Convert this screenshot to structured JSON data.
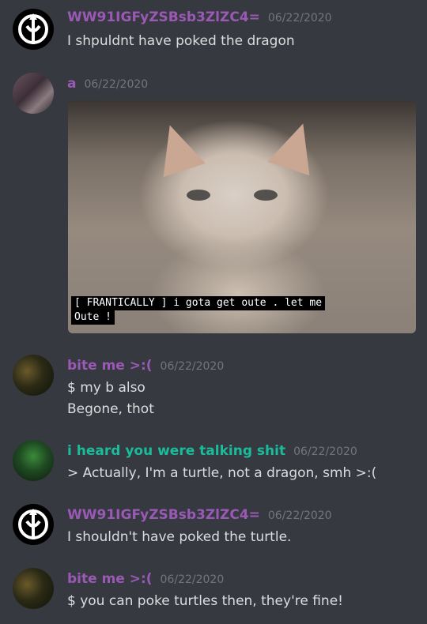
{
  "messages": [
    {
      "author": "WW91IGFyZSBsb3ZlZC4=",
      "timestamp": "06/22/2020",
      "lines": [
        "I shpuldnt have poked the dragon"
      ]
    },
    {
      "author": "a",
      "timestamp": "06/22/2020",
      "attachment": {
        "caption_line1": "[ FRANTICALLY ] i gota get oute .  let me",
        "caption_line2": "Oute !"
      }
    },
    {
      "author": "bite me >:(",
      "timestamp": "06/22/2020",
      "lines": [
        "$ my b also",
        "Begone, thot"
      ]
    },
    {
      "author": "i heard you were talking shit",
      "timestamp": "06/22/2020",
      "lines": [
        "> Actually, I'm a turtle, not a dragon, smh >:("
      ]
    },
    {
      "author": "WW91IGFyZSBsb3ZlZC4=",
      "timestamp": "06/22/2020",
      "lines": [
        "I shouldn't have poked the turtle."
      ]
    },
    {
      "author": "bite me >:(",
      "timestamp": "06/22/2020",
      "lines": [
        "$ you can poke turtles then, they're fine!"
      ]
    }
  ],
  "colors": {
    "background": "#36393f",
    "username_purple": "#9b59b6",
    "username_teal": "#1abc9c",
    "timestamp": "#72767d",
    "text": "#dcddde"
  }
}
